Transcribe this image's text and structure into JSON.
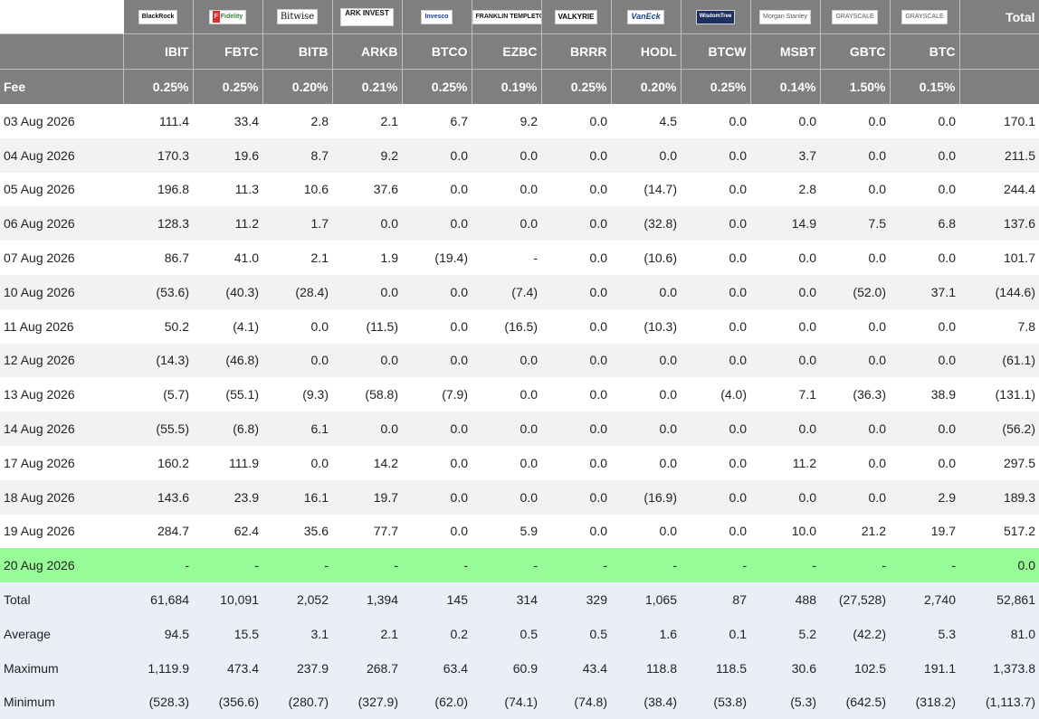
{
  "header": {
    "total_label": "Total",
    "fee_label": "Fee",
    "logos": [
      "BlackRock",
      "Fidelity",
      "Bitwise",
      "ARK INVEST",
      "Invesco",
      "FRANKLIN TEMPLETON",
      "VALKYRIE",
      "VanEck",
      "WisdomTree",
      "Morgan Stanley",
      "GRAYSCALE",
      "GRAYSCALE"
    ],
    "tickers": [
      "IBIT",
      "FBTC",
      "BITB",
      "ARKB",
      "BTCO",
      "EZBC",
      "BRRR",
      "HODL",
      "BTCW",
      "MSBT",
      "GBTC",
      "BTC"
    ],
    "fees": [
      "0.25%",
      "0.25%",
      "0.20%",
      "0.21%",
      "0.25%",
      "0.19%",
      "0.25%",
      "0.20%",
      "0.25%",
      "0.14%",
      "1.50%",
      "0.15%"
    ]
  },
  "rows": [
    {
      "date": "03 Aug 2026",
      "values": [
        "111.4",
        "33.4",
        "2.8",
        "2.1",
        "6.7",
        "9.2",
        "0.0",
        "4.5",
        "0.0",
        "0.0",
        "0.0",
        "0.0"
      ],
      "total": "170.1"
    },
    {
      "date": "04 Aug 2026",
      "values": [
        "170.3",
        "19.6",
        "8.7",
        "9.2",
        "0.0",
        "0.0",
        "0.0",
        "0.0",
        "0.0",
        "3.7",
        "0.0",
        "0.0"
      ],
      "total": "211.5"
    },
    {
      "date": "05 Aug 2026",
      "values": [
        "196.8",
        "11.3",
        "10.6",
        "37.6",
        "0.0",
        "0.0",
        "0.0",
        "(14.7)",
        "0.0",
        "2.8",
        "0.0",
        "0.0"
      ],
      "total": "244.4"
    },
    {
      "date": "06 Aug 2026",
      "values": [
        "128.3",
        "11.2",
        "1.7",
        "0.0",
        "0.0",
        "0.0",
        "0.0",
        "(32.8)",
        "0.0",
        "14.9",
        "7.5",
        "6.8"
      ],
      "total": "137.6"
    },
    {
      "date": "07 Aug 2026",
      "values": [
        "86.7",
        "41.0",
        "2.1",
        "1.9",
        "(19.4)",
        "-",
        "0.0",
        "(10.6)",
        "0.0",
        "0.0",
        "0.0",
        "0.0"
      ],
      "total": "101.7"
    },
    {
      "date": "10 Aug 2026",
      "values": [
        "(53.6)",
        "(40.3)",
        "(28.4)",
        "0.0",
        "0.0",
        "(7.4)",
        "0.0",
        "0.0",
        "0.0",
        "0.0",
        "(52.0)",
        "37.1"
      ],
      "total": "(144.6)"
    },
    {
      "date": "11 Aug 2026",
      "values": [
        "50.2",
        "(4.1)",
        "0.0",
        "(11.5)",
        "0.0",
        "(16.5)",
        "0.0",
        "(10.3)",
        "0.0",
        "0.0",
        "0.0",
        "0.0"
      ],
      "total": "7.8"
    },
    {
      "date": "12 Aug 2026",
      "values": [
        "(14.3)",
        "(46.8)",
        "0.0",
        "0.0",
        "0.0",
        "0.0",
        "0.0",
        "0.0",
        "0.0",
        "0.0",
        "0.0",
        "0.0"
      ],
      "total": "(61.1)"
    },
    {
      "date": "13 Aug 2026",
      "values": [
        "(5.7)",
        "(55.1)",
        "(9.3)",
        "(58.8)",
        "(7.9)",
        "0.0",
        "0.0",
        "0.0",
        "(4.0)",
        "7.1",
        "(36.3)",
        "38.9"
      ],
      "total": "(131.1)"
    },
    {
      "date": "14 Aug 2026",
      "values": [
        "(55.5)",
        "(6.8)",
        "6.1",
        "0.0",
        "0.0",
        "0.0",
        "0.0",
        "0.0",
        "0.0",
        "0.0",
        "0.0",
        "0.0"
      ],
      "total": "(56.2)"
    },
    {
      "date": "17 Aug 2026",
      "values": [
        "160.2",
        "111.9",
        "0.0",
        "14.2",
        "0.0",
        "0.0",
        "0.0",
        "0.0",
        "0.0",
        "11.2",
        "0.0",
        "0.0"
      ],
      "total": "297.5"
    },
    {
      "date": "18 Aug 2026",
      "values": [
        "143.6",
        "23.9",
        "16.1",
        "19.7",
        "0.0",
        "0.0",
        "0.0",
        "(16.9)",
        "0.0",
        "0.0",
        "0.0",
        "2.9"
      ],
      "total": "189.3"
    },
    {
      "date": "19 Aug 2026",
      "values": [
        "284.7",
        "62.4",
        "35.6",
        "77.7",
        "0.0",
        "5.9",
        "0.0",
        "0.0",
        "0.0",
        "10.0",
        "21.2",
        "19.7"
      ],
      "total": "517.2"
    },
    {
      "date": "20 Aug 2026",
      "values": [
        "-",
        "-",
        "-",
        "-",
        "-",
        "-",
        "-",
        "-",
        "-",
        "-",
        "-",
        "-"
      ],
      "total": "0.0",
      "highlight": true
    }
  ],
  "summary": [
    {
      "label": "Total",
      "values": [
        "61,684",
        "10,091",
        "2,052",
        "1,394",
        "145",
        "314",
        "329",
        "1,065",
        "87",
        "488",
        "(27,528)",
        "2,740"
      ],
      "total": "52,861"
    },
    {
      "label": "Average",
      "values": [
        "94.5",
        "15.5",
        "3.1",
        "2.1",
        "0.2",
        "0.5",
        "0.5",
        "1.6",
        "0.1",
        "5.2",
        "(42.2)",
        "5.3"
      ],
      "total": "81.0"
    },
    {
      "label": "Maximum",
      "values": [
        "1,119.9",
        "473.4",
        "237.9",
        "268.7",
        "63.4",
        "60.9",
        "43.4",
        "118.8",
        "118.5",
        "30.6",
        "102.5",
        "191.1"
      ],
      "total": "1,373.8"
    },
    {
      "label": "Minimum",
      "values": [
        "(528.3)",
        "(356.6)",
        "(280.7)",
        "(327.9)",
        "(62.0)",
        "(74.1)",
        "(74.8)",
        "(38.4)",
        "(53.8)",
        "(5.3)",
        "(642.5)",
        "(318.2)"
      ],
      "total": "(1,113.7)"
    }
  ],
  "colors": {
    "header_bg": "#7f7f7f",
    "negative": "#e0151a",
    "zero": "#bbbbbb",
    "highlight_row": "#97fb97",
    "summary_bg": "#e9eef8"
  }
}
